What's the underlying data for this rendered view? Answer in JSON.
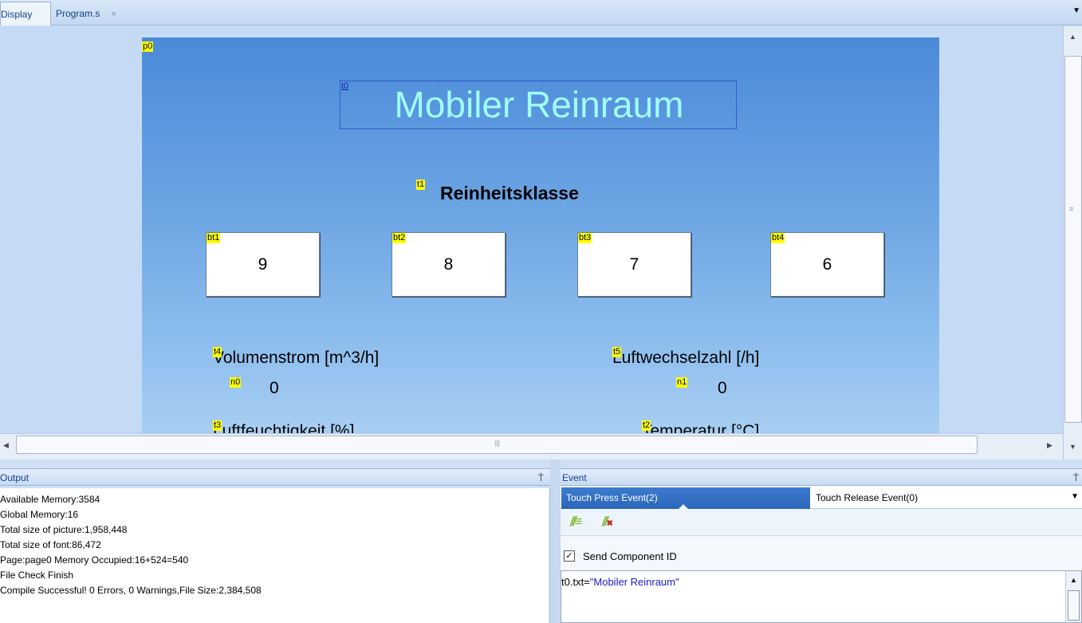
{
  "tabs": [
    {
      "label": "Display",
      "active": true
    },
    {
      "label": "Program.s",
      "close": "×",
      "active": false
    }
  ],
  "canvas": {
    "page_marker": "p0",
    "title": {
      "marker": "t0",
      "text": "Mobiler Reinraum",
      "color": "#9ffcff"
    },
    "subtitle": {
      "marker": "t1",
      "text": "Reinheitsklasse"
    },
    "class_buttons": [
      {
        "marker": "bt1",
        "value": "9"
      },
      {
        "marker": "bt2",
        "value": "8"
      },
      {
        "marker": "bt3",
        "value": "7"
      },
      {
        "marker": "bt4",
        "value": "6"
      }
    ],
    "labels": {
      "t4": {
        "marker": "t4",
        "text": "Volumenstrom [m^3/h]"
      },
      "t5": {
        "marker": "t5",
        "text": "Luftwechselzahl [/h]"
      },
      "t3": {
        "marker": "t3",
        "text": "Luftfeuchtigkeit [%]"
      },
      "t2": {
        "marker": "t2",
        "text": "Temperatur [°C]"
      }
    },
    "numbers": {
      "n0": {
        "marker": "n0",
        "value": "0"
      },
      "n1": {
        "marker": "n1",
        "value": "0"
      }
    },
    "marker_color": "#ffff00"
  },
  "output": {
    "title": "Output",
    "pin": "⍑",
    "lines": [
      "Available Memory:3584",
      "Global Memory:16",
      "Total size of picture:1,958,448",
      "Total size of font:86,472",
      "Page:page0 Memory Occupied:16+524=540",
      "File Check Finish",
      "Compile Successful! 0 Errors, 0 Warnings,File Size:2,384,508"
    ]
  },
  "event": {
    "title": "Event",
    "pin": "⍑",
    "tabs": [
      "Touch Press Event(2)",
      "Touch Release Event(0)"
    ],
    "send_component_id": {
      "label": "Send Component ID",
      "checked": true
    },
    "code": {
      "prefix": "t0.txt=",
      "string": "\"Mobiler Reinraum\""
    }
  }
}
